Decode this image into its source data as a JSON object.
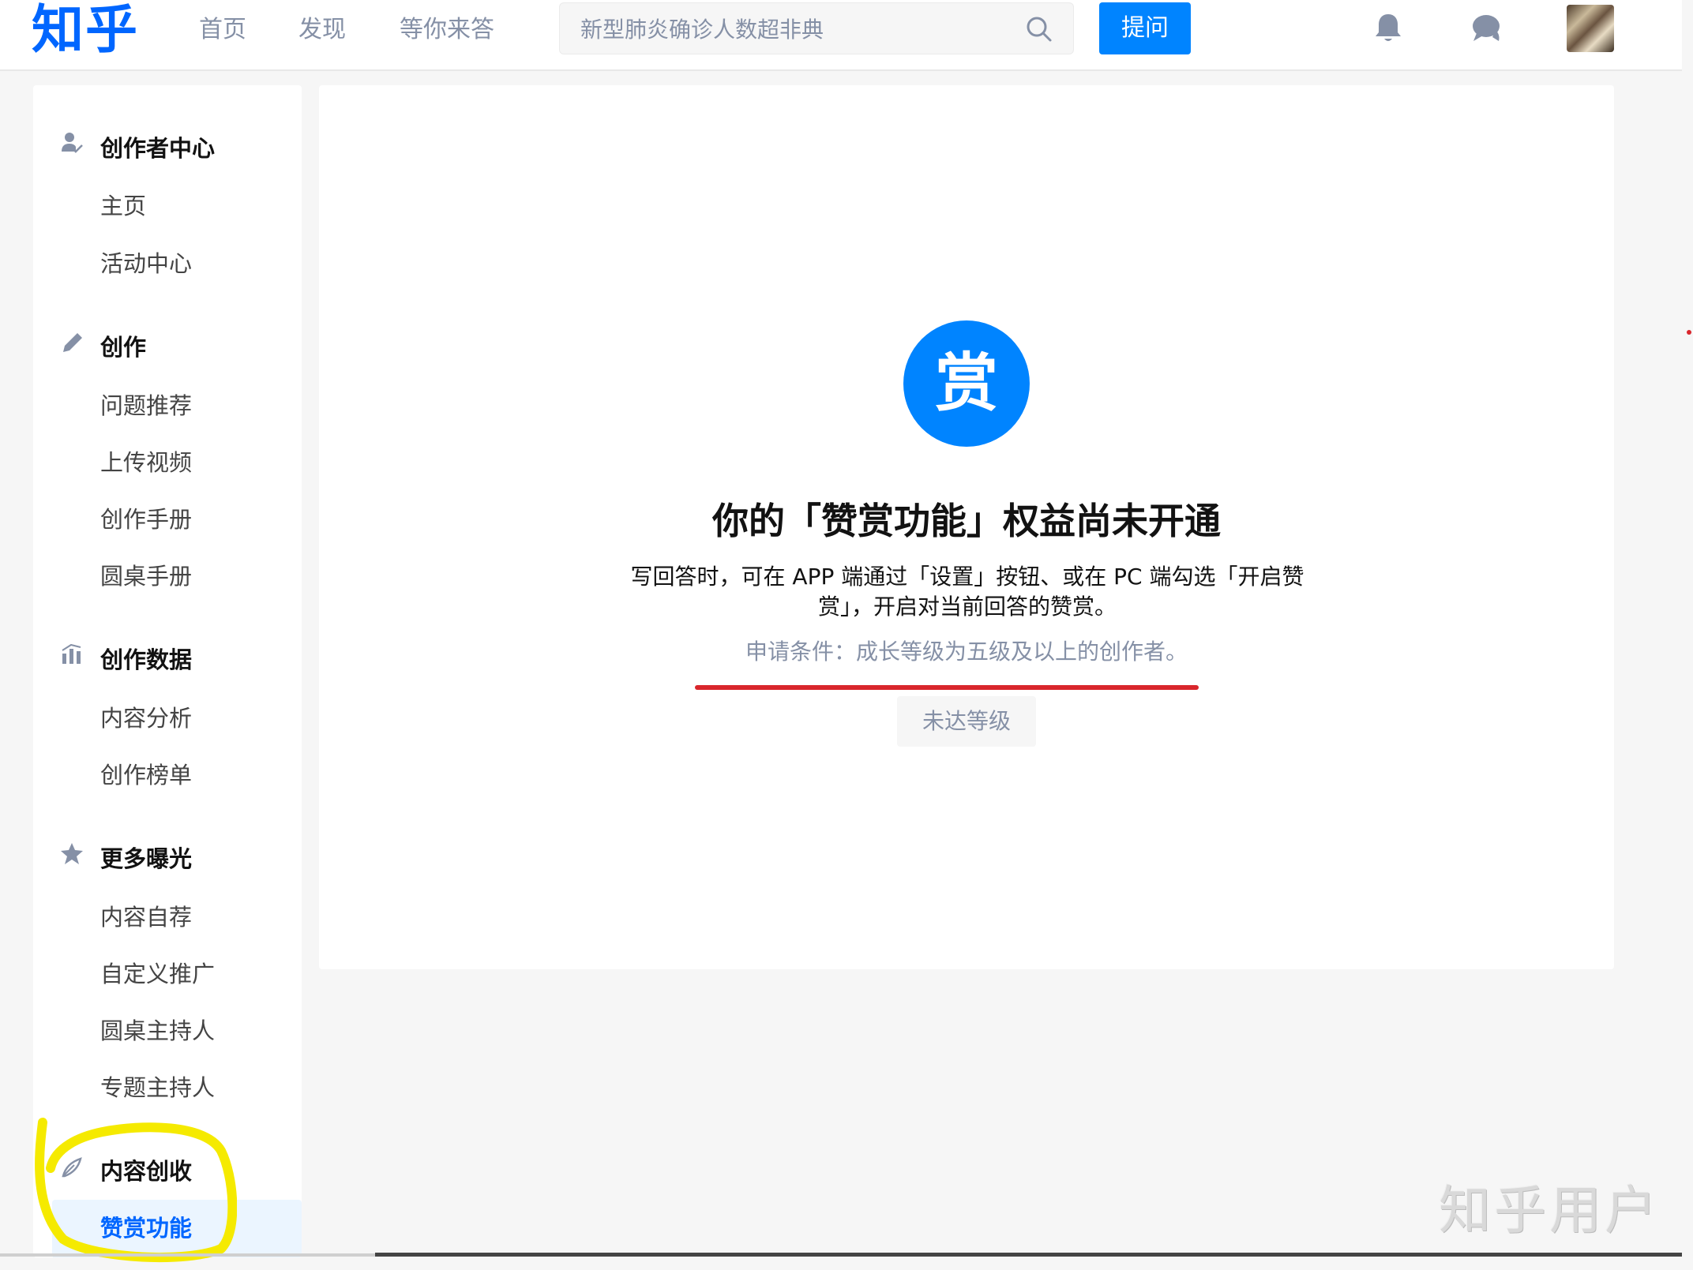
{
  "header": {
    "logo": "知乎",
    "nav": [
      "首页",
      "发现",
      "等你来答"
    ],
    "search_placeholder": "新型肺炎确诊人数超非典",
    "ask_label": "提问"
  },
  "sidebar": {
    "sections": [
      {
        "title": "创作者中心",
        "icon": "creator-icon",
        "items": [
          "主页",
          "活动中心"
        ]
      },
      {
        "title": "创作",
        "icon": "pencil-icon",
        "items": [
          "问题推荐",
          "上传视频",
          "创作手册",
          "圆桌手册"
        ]
      },
      {
        "title": "创作数据",
        "icon": "bar-chart-icon",
        "items": [
          "内容分析",
          "创作榜单"
        ]
      },
      {
        "title": "更多曝光",
        "icon": "star-icon",
        "items": [
          "内容自荐",
          "自定义推广",
          "圆桌主持人",
          "专题主持人"
        ]
      },
      {
        "title": "内容创收",
        "icon": "income-icon",
        "items": [
          "赞赏功能"
        ]
      }
    ],
    "active_item": "赞赏功能"
  },
  "main": {
    "badge_text": "赏",
    "title": "你的「赞赏功能」权益尚未开通",
    "description": "写回答时，可在 APP 端通过「设置」按钮、或在 PC 端勾选「开启赞赏」，开启对当前回答的赞赏。",
    "condition": "申请条件：成长等级为五级及以上的创作者。",
    "level_button": "未达等级"
  },
  "watermark": "知乎用户",
  "colors": {
    "brand_blue": "#0066ff",
    "button_blue": "#0084ff",
    "annotation_red": "#d9262c",
    "annotation_yellow": "#f5ea00"
  }
}
